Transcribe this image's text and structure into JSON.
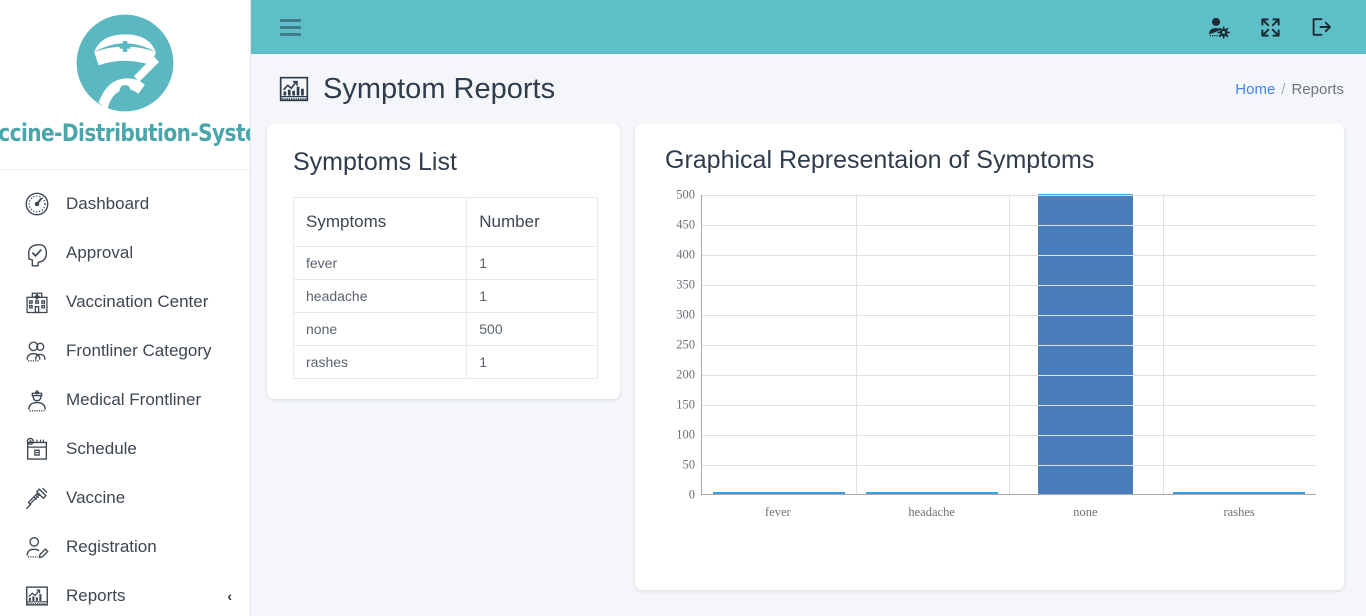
{
  "brand": {
    "title": "Vaccine-Distribution-System",
    "logo_icon": "nurse-with-syringe-logo",
    "color": "#4aa6ab"
  },
  "sidebar": {
    "items": [
      {
        "label": "Dashboard",
        "icon": "speedometer-icon"
      },
      {
        "label": "Approval",
        "icon": "head-check-icon"
      },
      {
        "label": "Vaccination Center",
        "icon": "hospital-icon"
      },
      {
        "label": "Frontliner Category",
        "icon": "people-group-icon"
      },
      {
        "label": "Medical Frontliner",
        "icon": "nurse-icon"
      },
      {
        "label": "Schedule",
        "icon": "calendar-clock-icon"
      },
      {
        "label": "Vaccine",
        "icon": "syringe-icon"
      },
      {
        "label": "Registration",
        "icon": "user-pencil-icon"
      },
      {
        "label": "Reports",
        "icon": "chart-report-icon",
        "caret": "‹"
      }
    ]
  },
  "topbar": {
    "menu_icon": "hamburger-icon",
    "background": "#5fbfc9",
    "icons": [
      {
        "name": "user-settings-icon"
      },
      {
        "name": "fullscreen-expand-icon"
      },
      {
        "name": "logout-icon"
      }
    ]
  },
  "page": {
    "title": "Symptom Reports",
    "title_icon": "chart-report-icon"
  },
  "breadcrumb": {
    "home": "Home",
    "separator": "/",
    "current": "Reports"
  },
  "symptoms_card": {
    "title": "Symptoms List",
    "columns": [
      "Symptoms",
      "Number"
    ],
    "rows": [
      {
        "symptom": "fever",
        "number": "1"
      },
      {
        "symptom": "headache",
        "number": "1"
      },
      {
        "symptom": "none",
        "number": "500"
      },
      {
        "symptom": "rashes",
        "number": "1"
      }
    ]
  },
  "chart_card": {
    "title": "Graphical Representaion of Symptoms"
  },
  "chart_data": {
    "type": "bar",
    "title": "Graphical Representaion of Symptoms",
    "categories": [
      "fever",
      "headache",
      "none",
      "rashes"
    ],
    "values": [
      1,
      1,
      500,
      1
    ],
    "xlabel": "",
    "ylabel": "",
    "ylim": [
      0,
      500
    ],
    "yticks": [
      0,
      50,
      100,
      150,
      200,
      250,
      300,
      350,
      400,
      450,
      500
    ],
    "ytick_labels": [
      "0",
      "50",
      "100",
      "150",
      "200",
      "250",
      "300",
      "350",
      "400",
      "450",
      "500"
    ],
    "grid": true,
    "legend": false,
    "bar_color": "#4a7ebb",
    "bar_edge_color": "#3c9ee0"
  }
}
